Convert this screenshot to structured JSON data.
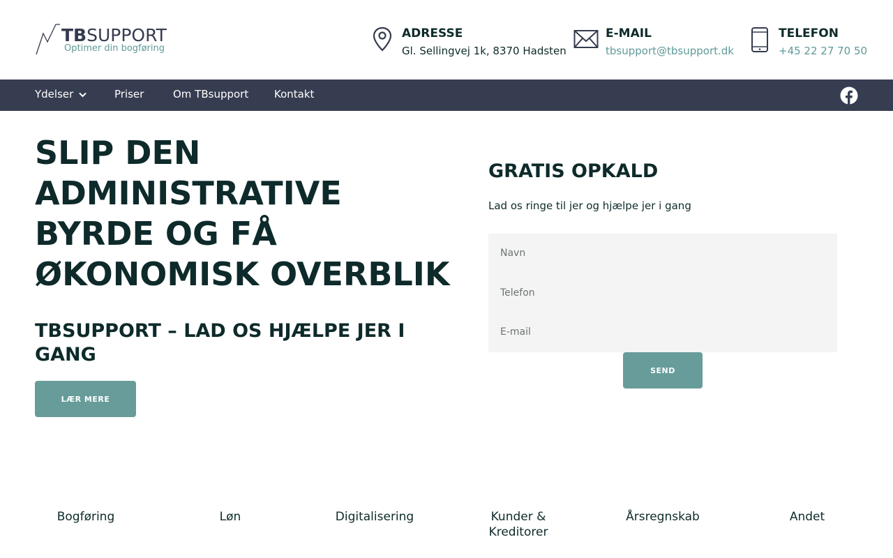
{
  "logo": {
    "title_bold": "TB",
    "title_rest": "SUPPORT",
    "tagline": "Optimer din bogføring"
  },
  "contact": {
    "address": {
      "label": "ADRESSE",
      "value": "Gl. Sellingvej 1k, 8370 Hadsten",
      "icon": "map-pin-icon"
    },
    "email": {
      "label": "E-MAIL",
      "value": "tbsupport@tbsupport.dk",
      "icon": "envelope-icon"
    },
    "phone": {
      "label": "TELEFON",
      "value": "+45 22 27 70 50",
      "icon": "mobile-phone-icon"
    }
  },
  "nav": {
    "items": [
      "Ydelser",
      "Priser",
      "Om TBsupport",
      "Kontakt"
    ],
    "social_icon": "facebook-icon"
  },
  "hero": {
    "title": "SLIP DEN ADMINISTRATIVE BYRDE OG FÅ ØKONOMISK OVERBLIK",
    "subtitle": "TBSUPPORT – LAD OS HJÆLPE JER I GANG",
    "button_label": "LÆR MERE"
  },
  "form": {
    "title": "GRATIS OPKALD",
    "description": "Lad os ringe til jer og hjælpe jer i gang",
    "name_placeholder": "Navn",
    "phone_placeholder": "Telefon",
    "email_placeholder": "E-mail",
    "submit_label": "SEND"
  },
  "services": [
    "Bogføring",
    "Løn",
    "Digitalisering",
    "Kunder & Kreditorer",
    "Årsregnskab",
    "Andet"
  ],
  "colors": {
    "nav_bg": "#373d51",
    "accent": "#679c9a",
    "text_dark": "#0e2a2a",
    "form_bg": "#f4f4f4"
  }
}
